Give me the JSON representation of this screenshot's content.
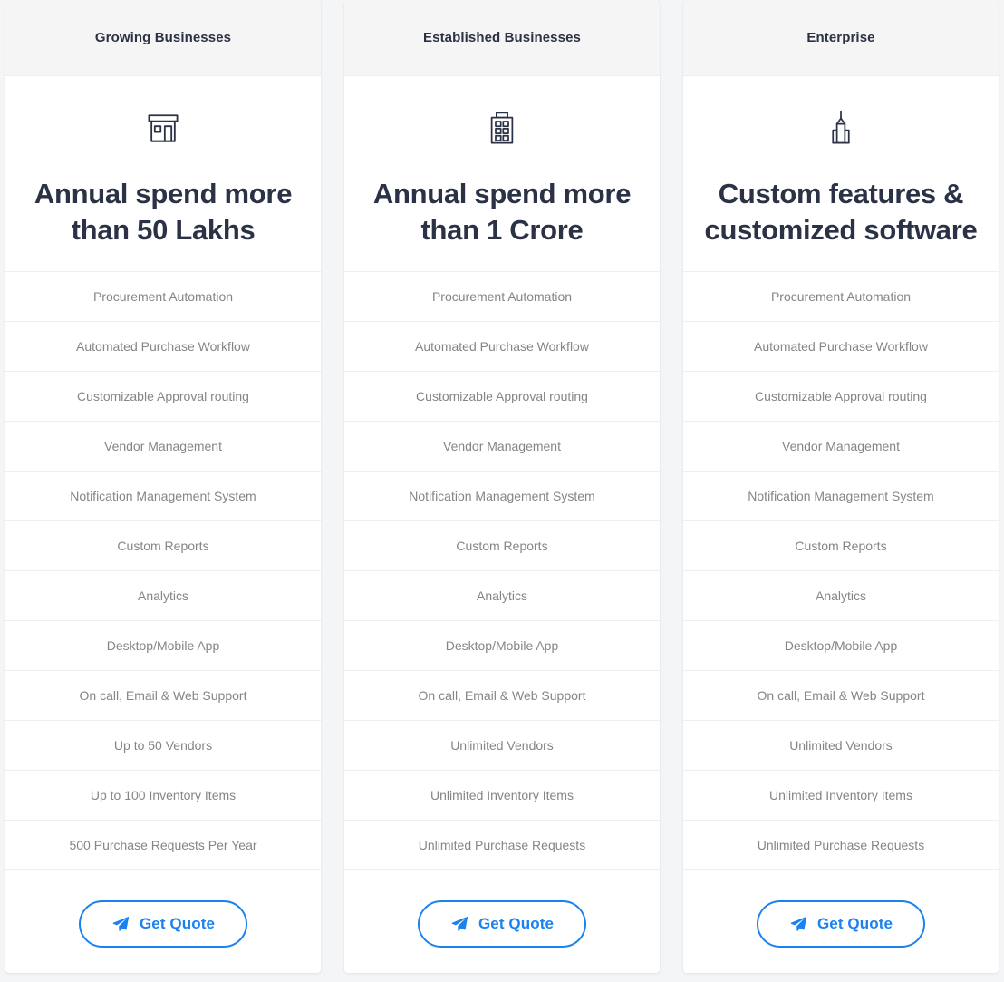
{
  "theme": {
    "page_background": "#f4f5f7",
    "card_background": "#ffffff",
    "header_background": "#f5f5f6",
    "heading_color": "#2b3245",
    "feature_text_color": "#858585",
    "accent_blue": "#1a82f0",
    "divider_color": "#efeff1"
  },
  "plans": [
    {
      "header": "Growing Businesses",
      "icon": "storefront-icon",
      "headline": "Annual spend more than 50 Lakhs",
      "features": [
        "Procurement Automation",
        "Automated Purchase Workflow",
        "Customizable Approval routing",
        "Vendor Management",
        "Notification Management System",
        "Custom Reports",
        "Analytics",
        "Desktop/Mobile App",
        "On call, Email & Web Support",
        "Up to 50 Vendors",
        "Up to 100 Inventory Items",
        "500 Purchase Requests Per Year"
      ],
      "cta": {
        "label": "Get Quote",
        "icon": "paper-plane-icon"
      }
    },
    {
      "header": "Established Businesses",
      "icon": "office-building-icon",
      "headline": "Annual spend more than 1 Crore",
      "features": [
        "Procurement Automation",
        "Automated Purchase Workflow",
        "Customizable Approval routing",
        "Vendor Management",
        "Notification Management System",
        "Custom Reports",
        "Analytics",
        "Desktop/Mobile App",
        "On call, Email & Web Support",
        "Unlimited Vendors",
        "Unlimited Inventory Items",
        "Unlimited Purchase Requests"
      ],
      "cta": {
        "label": "Get Quote",
        "icon": "paper-plane-icon"
      }
    },
    {
      "header": "Enterprise",
      "icon": "skyscraper-icon",
      "headline": "Custom features & customized software",
      "features": [
        "Procurement Automation",
        "Automated Purchase Workflow",
        "Customizable Approval routing",
        "Vendor Management",
        "Notification Management System",
        "Custom Reports",
        "Analytics",
        "Desktop/Mobile App",
        "On call, Email & Web Support",
        "Unlimited Vendors",
        "Unlimited Inventory Items",
        "Unlimited Purchase Requests"
      ],
      "cta": {
        "label": "Get Quote",
        "icon": "paper-plane-icon"
      }
    }
  ]
}
